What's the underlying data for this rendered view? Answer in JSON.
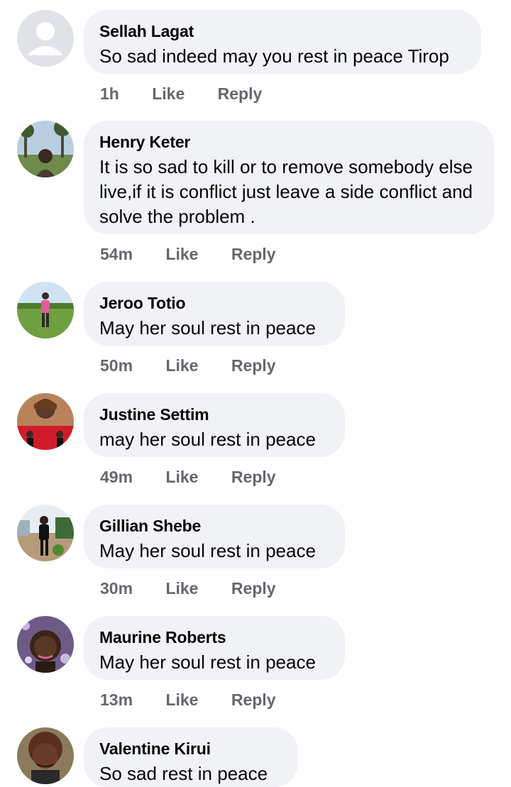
{
  "comments": [
    {
      "author": "Sellah Lagat",
      "text": "So sad indeed may you rest in peace Tirop",
      "time": "1h",
      "like": "Like",
      "reply": "Reply",
      "avatar": "default-avatar-icon"
    },
    {
      "author": "Henry Keter",
      "text": "It is so sad to kill or to remove somebody else live,if it is conflict just leave a side conflict and solve the problem .",
      "time": "54m",
      "like": "Like",
      "reply": "Reply",
      "avatar": "profile-photo"
    },
    {
      "author": "Jeroo Totio",
      "text": "May her soul rest in peace",
      "time": "50m",
      "like": "Like",
      "reply": "Reply",
      "avatar": "profile-photo"
    },
    {
      "author": "Justine Settim",
      "text": "may her soul rest in peace",
      "time": "49m",
      "like": "Like",
      "reply": "Reply",
      "avatar": "profile-photo"
    },
    {
      "author": "Gillian Shebe",
      "text": "May her soul rest in peace",
      "time": "30m",
      "like": "Like",
      "reply": "Reply",
      "avatar": "profile-photo"
    },
    {
      "author": "Maurine Roberts",
      "text": "May her soul rest in peace",
      "time": "13m",
      "like": "Like",
      "reply": "Reply",
      "avatar": "profile-photo"
    },
    {
      "author": "Valentine Kirui",
      "text": "So sad rest in peace",
      "avatar": "profile-photo"
    }
  ],
  "colors": {
    "bubble": "#f0f2f5",
    "meta": "#65676b",
    "text": "#050505"
  }
}
